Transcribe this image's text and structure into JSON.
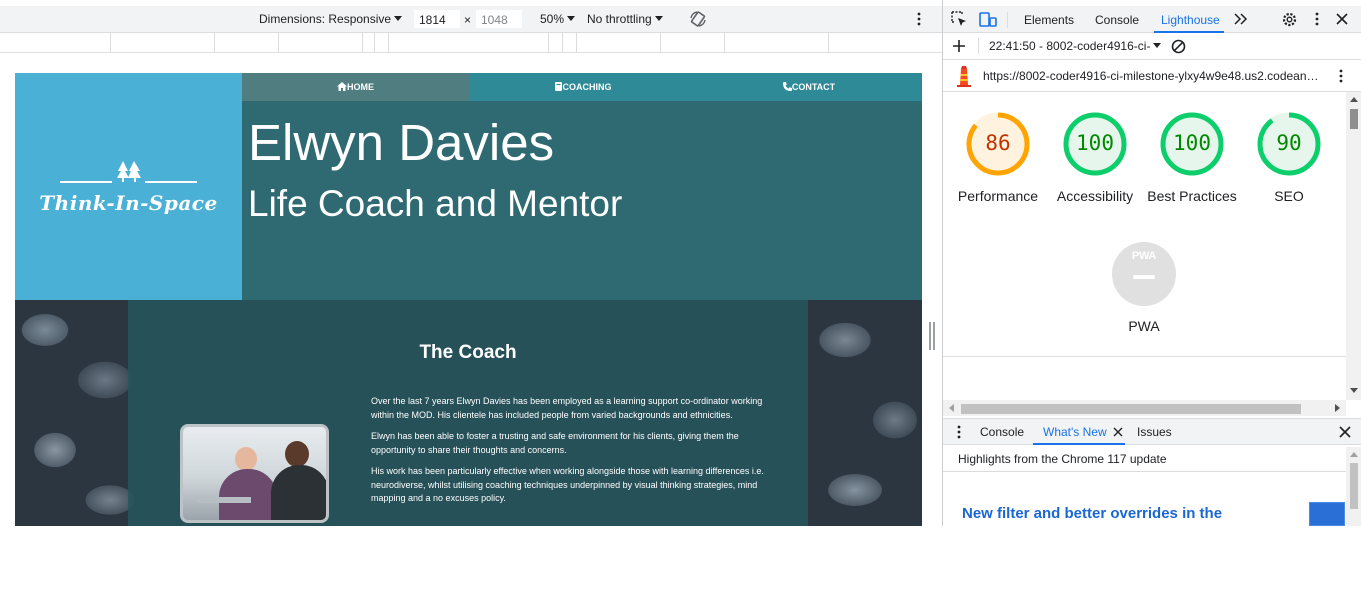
{
  "emulation_toolbar": {
    "dimensions_label": "Dimensions: Responsive",
    "width_value": "1814",
    "height_placeholder": "1048",
    "times_symbol": "×",
    "zoom_label": "50%",
    "throttling_label": "No throttling"
  },
  "site": {
    "logo_text": "Think-In-Space",
    "nav": [
      {
        "icon": "home-icon",
        "label": "HOME"
      },
      {
        "icon": "book-icon",
        "label": "COACHING"
      },
      {
        "icon": "phone-icon",
        "label": "CONTACT"
      }
    ],
    "hero_name": "Elwyn Davies",
    "hero_subtitle": "Life Coach and Mentor",
    "coach_title": "The Coach",
    "coach_paragraphs": [
      "Over the last 7 years Elwyn Davies has been employed as a learning support co-ordinator working within the MOD. His clientele has included people from varied backgrounds and ethnicities.",
      "Elwyn has been able to foster a trusting and safe environment for his clients, giving them the opportunity to share their thoughts and concerns.",
      "His work has been particularly effective when working alongside those with learning differences i.e. neurodiverse, whilst utilising coaching techniques underpinned by visual thinking strategies, mind mapping and a no excuses policy."
    ]
  },
  "devtools": {
    "tabs": [
      "Elements",
      "Console",
      "Lighthouse"
    ],
    "active_tab": "Lighthouse",
    "report_selector": "22:41:50 - 8002-coder4916-ci-",
    "report_url": "https://8002-coder4916-ci-milestone-ylxy4w9e48.us2.codean…",
    "scores": [
      {
        "label": "Performance",
        "value": "86",
        "score": 86,
        "color": "#c33300",
        "ring": "#ffa400",
        "fill": "#fff3e0"
      },
      {
        "label": "Accessibility",
        "value": "100",
        "score": 100,
        "color": "#008800",
        "ring": "#0cce6b",
        "fill": "#e6f6ec"
      },
      {
        "label": "Best Practices",
        "value": "100",
        "score": 100,
        "color": "#008800",
        "ring": "#0cce6b",
        "fill": "#e6f6ec"
      },
      {
        "label": "SEO",
        "value": "90",
        "score": 90,
        "color": "#008800",
        "ring": "#0cce6b",
        "fill": "#e6f6ec"
      }
    ],
    "pwa_label": "PWA",
    "pwa_badge_text": "PWA",
    "drawer_tabs": [
      "Console",
      "What's New",
      "Issues"
    ],
    "active_drawer_tab": "What's New",
    "highlights_text": "Highlights from the Chrome 117 update",
    "news_title": "New filter and better overrides in the"
  }
}
